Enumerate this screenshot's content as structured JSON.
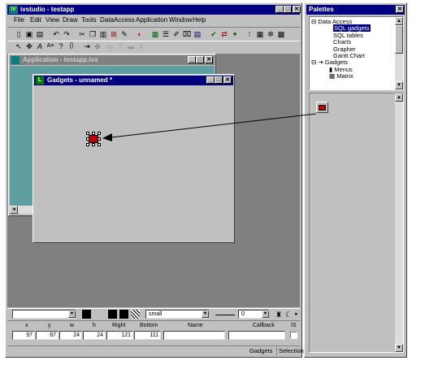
{
  "main_window": {
    "title": "ivstudio - testapp",
    "app_icon_text": "IV",
    "menu": [
      "File",
      "Edit",
      "View",
      "Draw",
      "Tools",
      "DataAccess",
      "Application",
      "Window",
      "Help"
    ],
    "title_buttons": [
      "_",
      "□",
      "✕"
    ]
  },
  "application_window": {
    "title": "Application - testapp.iva"
  },
  "gadgets_window": {
    "title": "Gadgets - unnamed *"
  },
  "palettes": {
    "title": "Palettes",
    "tree": [
      {
        "label": "Data Access",
        "level": 0,
        "expander": "⊟"
      },
      {
        "label": "SQL gadgets",
        "level": 1,
        "selected": true
      },
      {
        "label": "SQL tables",
        "level": 1
      },
      {
        "label": "Charts",
        "level": 1
      },
      {
        "label": "Grapher",
        "level": 1
      },
      {
        "label": "Gantt Chart",
        "level": 1
      },
      {
        "label": "Gadgets",
        "level": 0,
        "expander": "⊟"
      },
      {
        "label": "Menus",
        "level": 1
      },
      {
        "label": "Matrix",
        "level": 1
      }
    ]
  },
  "bottom_panel": {
    "font_size_value": "small",
    "line_width_value": "0",
    "headers": {
      "x": "x",
      "y": "y",
      "w": "w",
      "h": "h",
      "right": "Right",
      "bottom": "Bottom",
      "name": "Name",
      "callback": "Callback",
      "is": "IS"
    },
    "values": {
      "x": "97",
      "y": "87",
      "w": "24",
      "h": "24",
      "right": "121",
      "bottom": "111",
      "name": "",
      "callback": ""
    }
  },
  "status_bar": {
    "left": "Gadgets",
    "right": "Selection"
  },
  "colors": {
    "active_title": "#000080",
    "inactive_title": "#808080",
    "workspace": "#808080",
    "teal_workspace": "#5f9ea0",
    "face": "#c0c0c0"
  }
}
